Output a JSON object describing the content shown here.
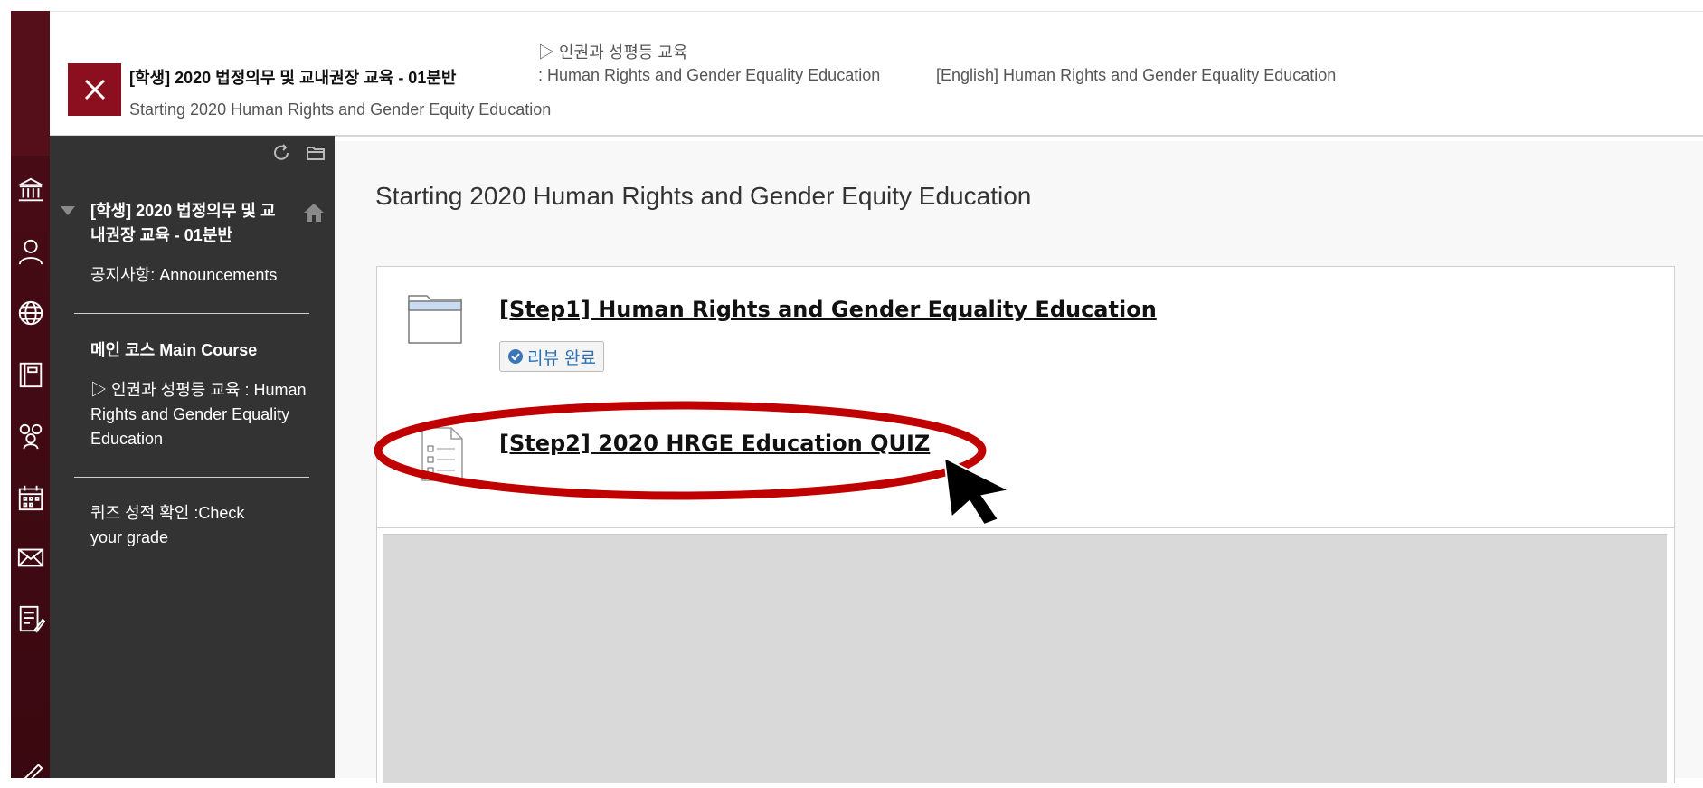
{
  "header": {
    "course_title": "[학생] 2020 법정의무 및 교내권장 교육 - 01분반",
    "breadcrumb_line1": "▷ 인권과 성평등 교육",
    "breadcrumb_line2": ": Human Rights and Gender Equality Education",
    "breadcrumb_english": "[English] Human Rights and Gender Equality Education",
    "page_subtitle": "Starting 2020 Human Rights and Gender Equity Education",
    "close_icon": "close-icon"
  },
  "course_menu": {
    "title": "[학생] 2020 법정의무 및 교내권장 교육 - 01분반",
    "items": [
      {
        "label": "공지사항: Announcements"
      },
      {
        "label": "메인 코스 Main Course"
      },
      {
        "label": "▷ 인권과 성평등 교육 : Human Rights and Gender Equality Education"
      },
      {
        "label": "퀴즈 성적 확인 :Check your grade"
      }
    ]
  },
  "content": {
    "title": "Starting 2020 Human Rights and Gender Equity Education",
    "items": [
      {
        "title": "[Step1] Human Rights and Gender Equality Education",
        "badge": "리뷰 완료",
        "icon": "folder-icon"
      },
      {
        "title": "[Step2] 2020 HRGE Education QUIZ",
        "icon": "quiz-document-icon"
      }
    ]
  },
  "colors": {
    "global_nav": "#4a0c17",
    "close_button": "#8c0f1f",
    "course_menu_bg": "#333333",
    "annotation_red": "#c00000",
    "link_blue": "#2a6fb0"
  }
}
